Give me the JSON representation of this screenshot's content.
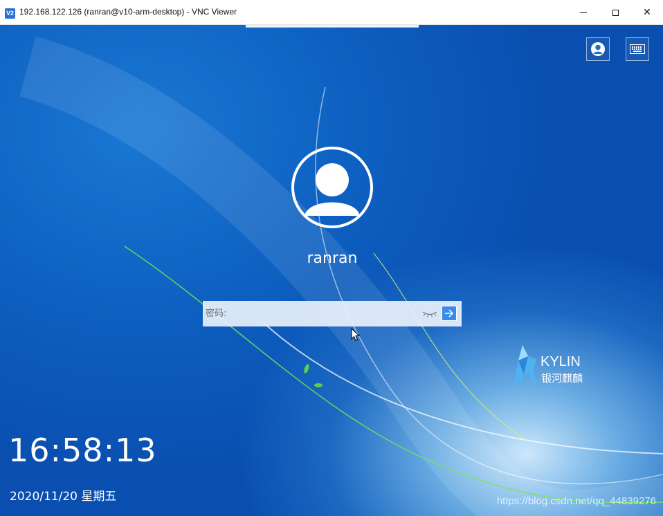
{
  "window": {
    "icon_text": "V2",
    "title": "192.168.122.126 (ranran@v10-arm-desktop) - VNC Viewer",
    "close_glyph": "✕"
  },
  "login": {
    "username": "ranran",
    "password_placeholder": "密码:",
    "icons": {
      "user_switch": "user-icon",
      "keyboard": "keyboard-icon",
      "show_password": "eye-closed-icon",
      "submit": "arrow-right-icon"
    }
  },
  "brand": {
    "logo_text": "KYLIN",
    "logo_subtext": "银河麒麟"
  },
  "clock": {
    "time": "16:58:13",
    "date": "2020/11/20 星期五"
  },
  "watermark": "https://blog.csdn.net/qq_44839276",
  "colors": {
    "desktop_blue": "#0d5fc0",
    "submit_blue": "#3b8be6"
  }
}
